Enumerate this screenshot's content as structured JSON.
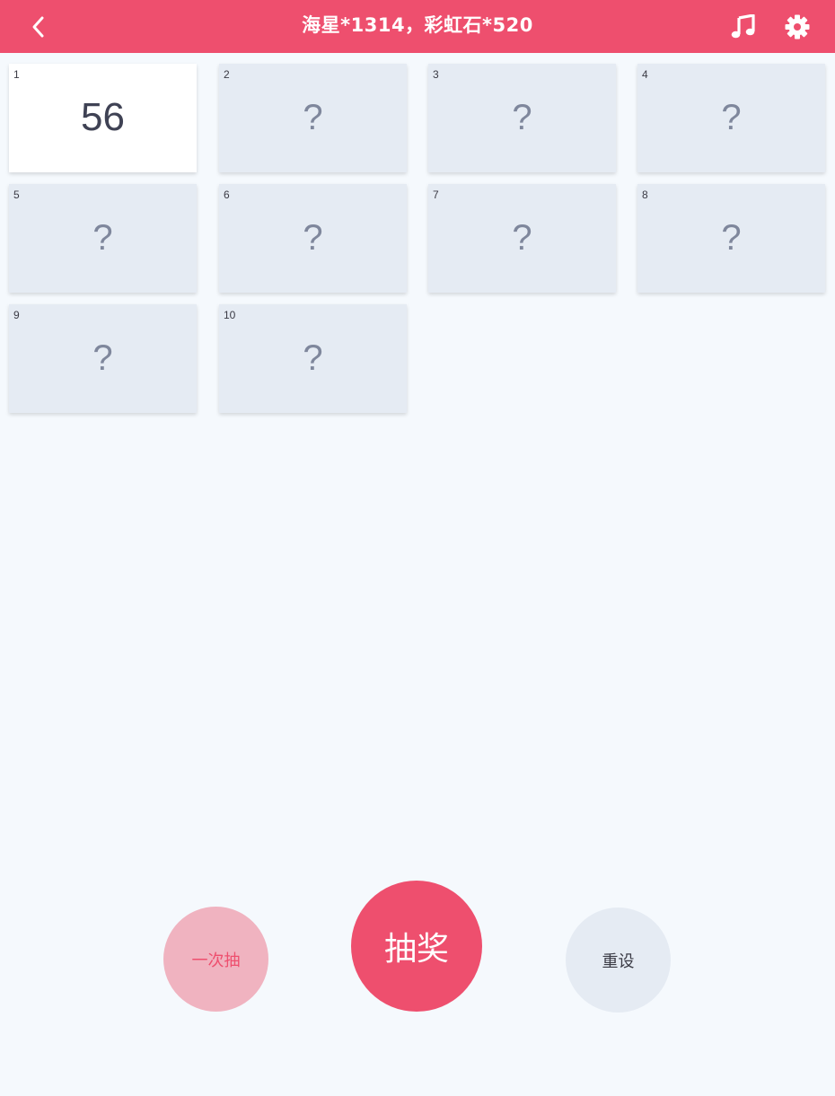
{
  "header": {
    "title": "海星*1314，彩虹石*520"
  },
  "cards": [
    {
      "num": "1",
      "value": "56",
      "revealed": true
    },
    {
      "num": "2",
      "value": "?",
      "revealed": false
    },
    {
      "num": "3",
      "value": "?",
      "revealed": false
    },
    {
      "num": "4",
      "value": "?",
      "revealed": false
    },
    {
      "num": "5",
      "value": "?",
      "revealed": false
    },
    {
      "num": "6",
      "value": "?",
      "revealed": false
    },
    {
      "num": "7",
      "value": "?",
      "revealed": false
    },
    {
      "num": "8",
      "value": "?",
      "revealed": false
    },
    {
      "num": "9",
      "value": "?",
      "revealed": false
    },
    {
      "num": "10",
      "value": "?",
      "revealed": false
    }
  ],
  "buttons": {
    "once_label": "一次抽",
    "draw_label": "抽奖",
    "reset_label": "重设"
  },
  "colors": {
    "accent": "#ee4f6e",
    "card_hidden": "#e5ebf3",
    "card_revealed": "#ffffff",
    "background": "#f5f9fd"
  },
  "icons": {
    "back": "chevron-left-icon",
    "music": "music-note-icon",
    "settings": "gear-icon"
  }
}
